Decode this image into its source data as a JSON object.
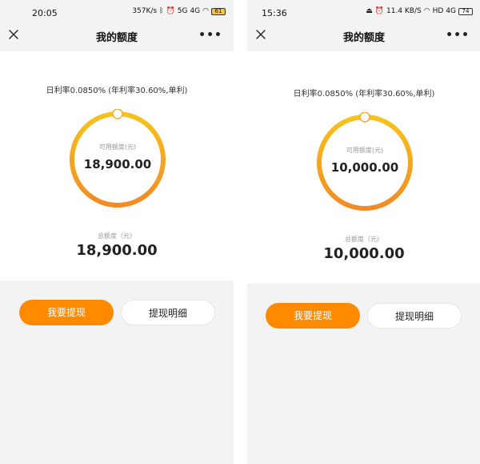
{
  "screens": [
    {
      "status": {
        "time": "20:05",
        "speed": "357K/s",
        "signal1": "5G",
        "signal2": "4G",
        "wifi": "wifi",
        "battery": "61"
      },
      "nav": {
        "title": "我的额度"
      },
      "rate_text": "日利率0.0850% (年利率30.60%,单利)",
      "available": {
        "label": "可用额度(元)",
        "value": "18,900.00"
      },
      "total": {
        "label": "总额度（元）",
        "value": "18,900.00"
      },
      "actions": {
        "withdraw": "我要提现",
        "details": "提现明细"
      }
    },
    {
      "status": {
        "time": "15:36",
        "speed": "11.4 KB/S",
        "signal1": "HD",
        "signal2": "4G",
        "wifi": "wifi",
        "battery": "74"
      },
      "nav": {
        "title": "我的额度"
      },
      "rate_text": "日利率0.0850% (年利率30.60%,单利)",
      "available": {
        "label": "可用额度(元)",
        "value": "10,000.00"
      },
      "total": {
        "label": "总额度（元）",
        "value": "10,000.00"
      },
      "actions": {
        "withdraw": "我要提现",
        "details": "提现明细"
      }
    }
  ],
  "colors": {
    "accent": "#ff8a00",
    "ring_start": "#f7c31c",
    "ring_end": "#f38a24",
    "background": "#f3f3f3"
  },
  "icons": {
    "close": "close-icon",
    "more": "more-icon",
    "bluetooth": "bluetooth-icon",
    "alarm": "alarm-icon",
    "wifi": "wifi-icon",
    "battery": "battery-icon"
  }
}
